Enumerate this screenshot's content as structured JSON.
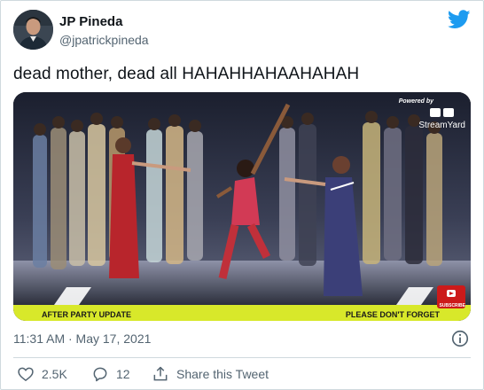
{
  "author": {
    "display_name": "JP Pineda",
    "handle": "@jpatrickpineda"
  },
  "tweet": {
    "text": "dead mother, dead all HAHAHHAHAAHAHAH",
    "timestamp": "11:31 AM · May 17, 2021"
  },
  "media": {
    "powered_by": "Powered by",
    "stream_brand": "StreamYard",
    "banner_left": "AFTER PARTY UPDATE",
    "banner_right": "PLEASE DON'T FORGET",
    "subscribe_label": "SUBSCRIBE"
  },
  "actions": {
    "like_count": "2.5K",
    "reply_count": "12",
    "share_label": "Share this Tweet"
  },
  "icons": {
    "brand": "twitter-bird-icon",
    "info": "info-icon",
    "like": "heart-icon",
    "reply": "reply-bubble-icon",
    "share": "share-icon"
  },
  "colors": {
    "twitter_blue": "#1d9bf0",
    "secondary_text": "#536471",
    "banner_yellow": "#d8e82a",
    "subscribe_red": "#cc1a1a"
  }
}
